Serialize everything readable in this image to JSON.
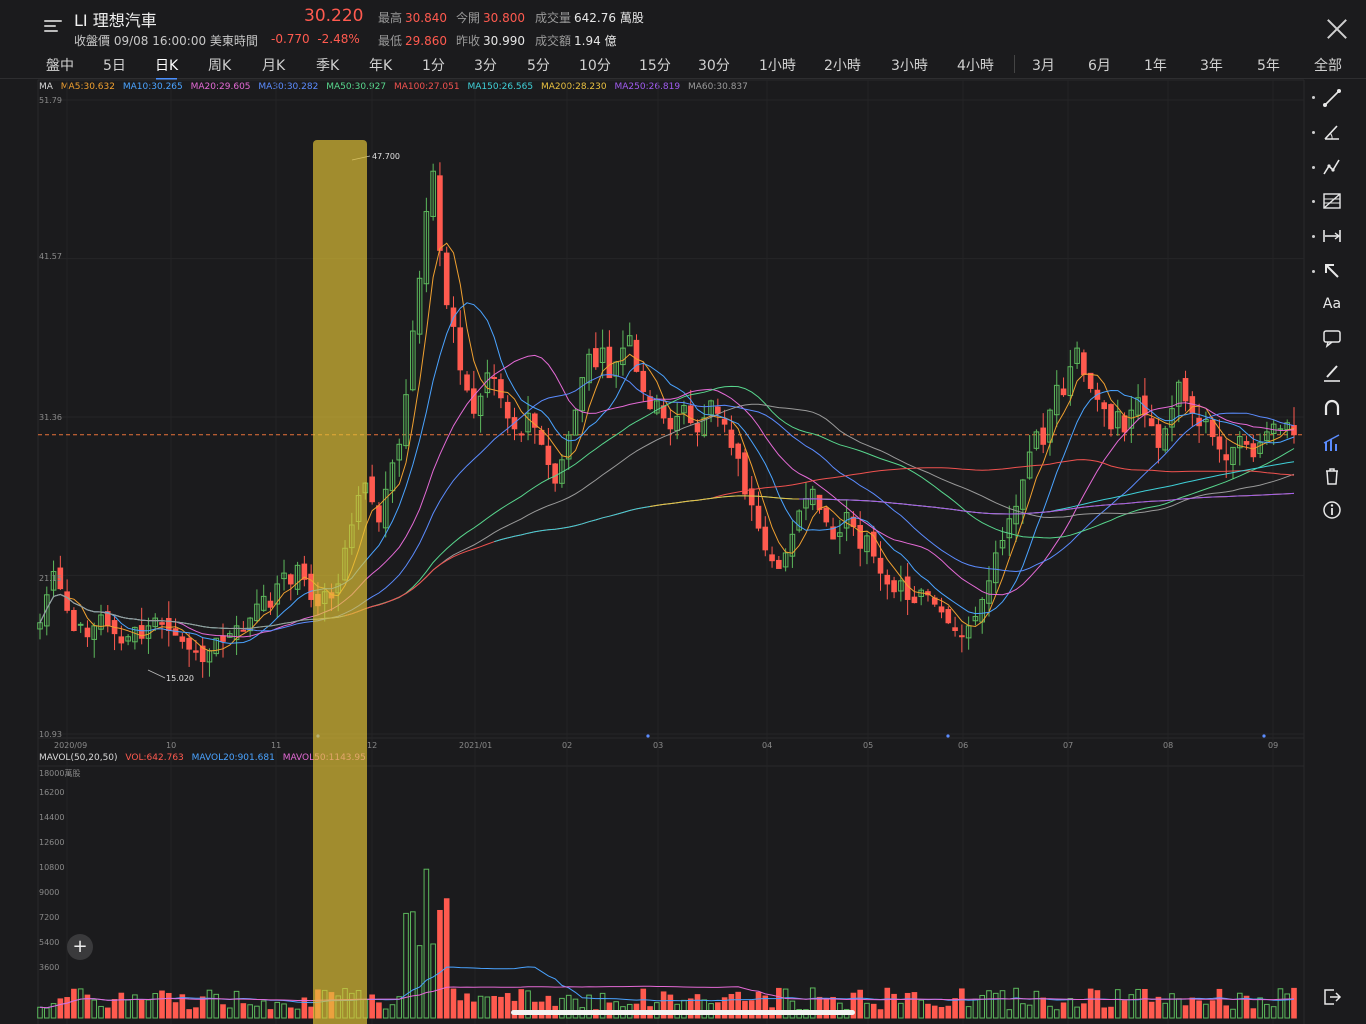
{
  "header": {
    "symbol": "LI 理想汽車",
    "close_time": "收盤價 09/08 16:00:00 美東時間",
    "price": "30.220",
    "change": "-0.770",
    "change_pct": "-2.48%",
    "stats": {
      "high_label": "最高",
      "high": "30.840",
      "open_label": "今開",
      "open": "30.800",
      "volume_label": "成交量",
      "volume": "642.76 萬股",
      "low_label": "最低",
      "low": "29.860",
      "prev_close_label": "昨收",
      "prev_close": "30.990",
      "turnover_label": "成交額",
      "turnover": "1.94 億"
    }
  },
  "tabs": [
    "盤中",
    "5日",
    "日K",
    "周K",
    "月K",
    "季K",
    "年K",
    "1分",
    "3分",
    "5分",
    "10分",
    "15分",
    "30分",
    "1小時",
    "2小時",
    "3小時",
    "4小時",
    "3月",
    "6月",
    "1年",
    "3年",
    "5年",
    "全部"
  ],
  "active_tab": "日K",
  "ma_legend": {
    "label": "MA",
    "items": [
      {
        "text": "MA5:30.632",
        "color": "#f0a030"
      },
      {
        "text": "MA10:30.265",
        "color": "#4aa3ff"
      },
      {
        "text": "MA20:29.605",
        "color": "#e46ad6"
      },
      {
        "text": "MA30:30.282",
        "color": "#5b8cff"
      },
      {
        "text": "MA50:30.927",
        "color": "#58d68d"
      },
      {
        "text": "MA100:27.051",
        "color": "#f0524f"
      },
      {
        "text": "MA150:26.565",
        "color": "#3fd0d8"
      },
      {
        "text": "MA200:28.230",
        "color": "#e8c040"
      },
      {
        "text": "MA250:26.819",
        "color": "#a05cf0"
      },
      {
        "text": "MA60:30.837",
        "color": "#9a9a9a"
      }
    ]
  },
  "vol_legend": {
    "items": [
      {
        "text": "MAVOL(50,20,50)",
        "color": "#d8d8d8"
      },
      {
        "text": "VOL:642.763",
        "color": "#ff5a4f"
      },
      {
        "text": "MAVOL20:901.681",
        "color": "#4aa3ff"
      },
      {
        "text": "MAVOL50:1143.95",
        "color": "#e46ad6"
      }
    ]
  },
  "price_axis": [
    "51.79",
    "41.57",
    "31.36",
    "21.15",
    "10.93"
  ],
  "x_axis": [
    "2020/09",
    "10",
    "11",
    "12",
    "2021/01",
    "02",
    "03",
    "04",
    "05",
    "06",
    "07",
    "08",
    "09"
  ],
  "volume_axis": [
    "18000萬股",
    "16200",
    "14400",
    "12600",
    "10800",
    "9000",
    "7200",
    "5400",
    "3600"
  ],
  "annotations": {
    "high": "47.700",
    "low": "15.020"
  },
  "toolbar": [
    "trendline-tool",
    "angle-tool",
    "polyline-tool",
    "fib-tool",
    "measure-tool",
    "arrow-tool",
    "text-tool",
    "comment-tool",
    "brush-tool",
    "magnet-tool",
    "indicator-tool",
    "delete-tool",
    "info-tool",
    "exit-tool"
  ],
  "chart_data": {
    "type": "candlestick",
    "ylim": [
      10.93,
      51.79
    ],
    "last_price_line": 30.22,
    "close": [
      18.1,
      19.9,
      21.4,
      20.3,
      18.9,
      17.6,
      18.0,
      17.2,
      17.9,
      18.6,
      17.9,
      17.4,
      16.8,
      17.2,
      17.8,
      17.1,
      17.9,
      18.4,
      18.0,
      17.6,
      17.3,
      16.9,
      16.4,
      16.2,
      15.6,
      16.3,
      17.1,
      16.9,
      17.4,
      17.9,
      17.6,
      18.4,
      19.3,
      19.8,
      19.1,
      20.6,
      21.3,
      20.6,
      21.8,
      20.9,
      19.6,
      19.2,
      20.1,
      19.7,
      20.6,
      22.9,
      24.4,
      26.3,
      27.1,
      25.9,
      24.6,
      26.7,
      28.4,
      29.6,
      32.8,
      36.9,
      40.3,
      44.6,
      47.2,
      42.1,
      38.6,
      37.2,
      34.4,
      33.1,
      31.6,
      32.7,
      34.2,
      33.9,
      32.6,
      31.3,
      30.6,
      30.2,
      31.6,
      30.7,
      29.6,
      28.3,
      27.1,
      28.6,
      30.2,
      31.8,
      33.9,
      35.4,
      34.6,
      35.8,
      33.9,
      34.9,
      35.8,
      36.6,
      34.3,
      33.0,
      31.9,
      32.4,
      31.3,
      30.6,
      31.4,
      32.1,
      31.0,
      30.4,
      31.3,
      32.4,
      31.6,
      30.9,
      29.4,
      28.7,
      26.4,
      25.7,
      24.2,
      22.8,
      22.1,
      21.6,
      22.6,
      23.8,
      25.3,
      26.1,
      26.7,
      25.4,
      24.6,
      23.5,
      23.9,
      25.2,
      24.3,
      22.9,
      23.7,
      22.4,
      21.3,
      20.6,
      20.1,
      20.8,
      19.6,
      19.4,
      20.2,
      19.9,
      19.3,
      18.8,
      18.1,
      17.6,
      17.2,
      17.9,
      18.5,
      19.6,
      20.8,
      22.6,
      23.4,
      24.8,
      25.6,
      27.3,
      29.1,
      30.4,
      29.6,
      31.8,
      33.4,
      32.8,
      34.6,
      35.8,
      34.1,
      33.2,
      32.5,
      31.9,
      30.6,
      31.7,
      30.4,
      31.8,
      32.6,
      31.5,
      30.8,
      29.4,
      30.6,
      31.9,
      33.6,
      32.4,
      31.6,
      30.8,
      31.2,
      30.1,
      29.3,
      28.6,
      29.4,
      30.1,
      29.6,
      28.8,
      29.7,
      30.4,
      30.9,
      30.6,
      30.99,
      30.22
    ],
    "high": 47.7,
    "low": 15.02
  }
}
